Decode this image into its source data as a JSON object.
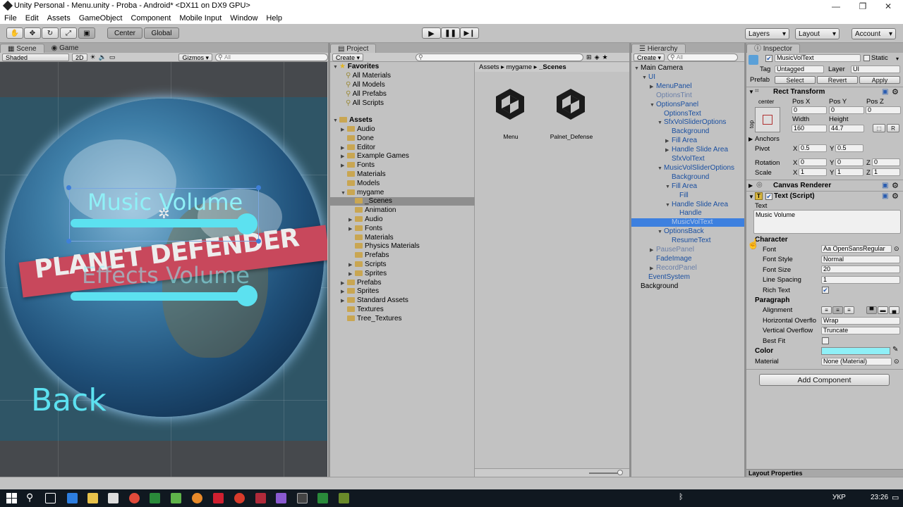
{
  "window": {
    "title": "Unity Personal - Menu.unity - Proba - Android* <DX11 on DX9 GPU>",
    "minimize": "—",
    "maximize": "❐",
    "close": "✕"
  },
  "menu": [
    "File",
    "Edit",
    "Assets",
    "GameObject",
    "Component",
    "Mobile Input",
    "Window",
    "Help"
  ],
  "toolbar": {
    "center": "Center",
    "global": "Global",
    "layers": "Layers",
    "layout": "Layout",
    "account": "Account"
  },
  "scene_panel": {
    "tabs": [
      "Scene",
      "Game"
    ],
    "shaded": "Shaded",
    "mode2d": "2D",
    "gizmos": "Gizmos",
    "search_placeholder": "All",
    "music_volume": "Music Volume",
    "effects_volume": "Effects Volume",
    "banner": "PLANET DEFENDER",
    "back": "Back",
    "colors": {
      "accent": "#5ce1f0",
      "banner": "#c8485c"
    }
  },
  "project_panel": {
    "tab": "Project",
    "create": "Create",
    "favorites_label": "Favorites",
    "favorites": [
      "All Materials",
      "All Models",
      "All Prefabs",
      "All Scripts"
    ],
    "assets_label": "Assets",
    "assets_tree": [
      {
        "label": "Audio",
        "depth": 1
      },
      {
        "label": "Done",
        "depth": 1
      },
      {
        "label": "Editor",
        "depth": 1
      },
      {
        "label": "Example Games",
        "depth": 1
      },
      {
        "label": "Fonts",
        "depth": 1
      },
      {
        "label": "Materials",
        "depth": 1
      },
      {
        "label": "Models",
        "depth": 1
      },
      {
        "label": "mygame",
        "depth": 1
      },
      {
        "label": "_Scenes",
        "depth": 2
      },
      {
        "label": "Animation",
        "depth": 2
      },
      {
        "label": "Audio",
        "depth": 2
      },
      {
        "label": "Fonts",
        "depth": 2
      },
      {
        "label": "Materials",
        "depth": 2
      },
      {
        "label": "Physics Materials",
        "depth": 2
      },
      {
        "label": "Prefabs",
        "depth": 2
      },
      {
        "label": "Scripts",
        "depth": 2
      },
      {
        "label": "Sprites",
        "depth": 2
      },
      {
        "label": "Prefabs",
        "depth": 1
      },
      {
        "label": "Sprites",
        "depth": 1
      },
      {
        "label": "Standard Assets",
        "depth": 1
      },
      {
        "label": "Textures",
        "depth": 1
      },
      {
        "label": "Tree_Textures",
        "depth": 1
      }
    ],
    "breadcrumb": [
      "Assets",
      "mygame",
      "_Scenes"
    ],
    "files": [
      "Menu",
      "Palnet_Defense"
    ]
  },
  "hierarchy_panel": {
    "tab": "Hierarchy",
    "create": "Create",
    "search_placeholder": "All",
    "items": [
      {
        "label": "Main Camera",
        "depth": 0,
        "style": "normal"
      },
      {
        "label": "UI",
        "depth": 1,
        "style": "blue"
      },
      {
        "label": "MenuPanel",
        "depth": 2,
        "style": "blue"
      },
      {
        "label": "OptionsTint",
        "depth": 2,
        "style": "grey"
      },
      {
        "label": "OptionsPanel",
        "depth": 2,
        "style": "blue"
      },
      {
        "label": "OptionsText",
        "depth": 3,
        "style": "blue"
      },
      {
        "label": "SfxVolSliderOptions",
        "depth": 3,
        "style": "blue"
      },
      {
        "label": "Background",
        "depth": 4,
        "style": "blue"
      },
      {
        "label": "Fill Area",
        "depth": 4,
        "style": "blue"
      },
      {
        "label": "Handle Slide Area",
        "depth": 4,
        "style": "blue"
      },
      {
        "label": "SfxVolText",
        "depth": 4,
        "style": "blue"
      },
      {
        "label": "MusicVolSliderOptions",
        "depth": 3,
        "style": "blue"
      },
      {
        "label": "Background",
        "depth": 4,
        "style": "blue"
      },
      {
        "label": "Fill Area",
        "depth": 4,
        "style": "blue"
      },
      {
        "label": "Fill",
        "depth": 5,
        "style": "blue"
      },
      {
        "label": "Handle Slide Area",
        "depth": 4,
        "style": "blue"
      },
      {
        "label": "Handle",
        "depth": 5,
        "style": "blue"
      },
      {
        "label": "MusicVolText",
        "depth": 4,
        "style": "selected"
      },
      {
        "label": "OptionsBack",
        "depth": 3,
        "style": "blue"
      },
      {
        "label": "ResumeText",
        "depth": 4,
        "style": "blue"
      },
      {
        "label": "PausePanel",
        "depth": 2,
        "style": "grey"
      },
      {
        "label": "FadeImage",
        "depth": 2,
        "style": "blue"
      },
      {
        "label": "RecordPanel",
        "depth": 2,
        "style": "grey"
      },
      {
        "label": "EventSystem",
        "depth": 1,
        "style": "blue"
      },
      {
        "label": "Background",
        "depth": 0,
        "style": "normal"
      }
    ]
  },
  "inspector": {
    "tab": "Inspector",
    "object_name": "MusicVolText",
    "static": "Static",
    "tag_label": "Tag",
    "tag_value": "Untagged",
    "layer_label": "Layer",
    "layer_value": "UI",
    "prefab_label": "Prefab",
    "prefab_select": "Select",
    "prefab_revert": "Revert",
    "prefab_apply": "Apply",
    "rect_transform": "Rect Transform",
    "anchor_preset_label": "center",
    "anchor_side_label": "top",
    "pos_x_label": "Pos X",
    "pos_y_label": "Pos Y",
    "pos_z_label": "Pos Z",
    "pos_x": "0",
    "pos_y": "0",
    "pos_z": "0",
    "width_label": "Width",
    "height_label": "Height",
    "width": "160",
    "height": "44.7",
    "anchors": "Anchors",
    "pivot": "Pivot",
    "pivot_x": "0.5",
    "pivot_y": "0.5",
    "rotation": "Rotation",
    "rot_x": "0",
    "rot_y": "0",
    "rot_z": "0",
    "scale": "Scale",
    "scale_x": "1",
    "scale_y": "1",
    "scale_z": "1",
    "canvas_renderer": "Canvas Renderer",
    "text_script": "Text (Script)",
    "text_label": "Text",
    "text_value": "Music Volume",
    "character": "Character",
    "font_label": "Font",
    "font_value": "OpenSansRegular",
    "font_style_label": "Font Style",
    "font_style_value": "Normal",
    "font_size_label": "Font Size",
    "font_size_value": "20",
    "line_spacing_label": "Line Spacing",
    "line_spacing_value": "1",
    "rich_text_label": "Rich Text",
    "paragraph": "Paragraph",
    "alignment_label": "Alignment",
    "h_overflow_label": "Horizontal Overflo",
    "h_overflow_value": "Wrap",
    "v_overflow_label": "Vertical Overflow",
    "v_overflow_value": "Truncate",
    "best_fit_label": "Best Fit",
    "color_label": "Color",
    "color_value": "#8ff0f7",
    "material_label": "Material",
    "material_value": "None (Material)",
    "add_component": "Add Component",
    "layout_properties": "Layout Properties"
  },
  "taskbar": {
    "lang": "УКР",
    "time": "23:26"
  }
}
